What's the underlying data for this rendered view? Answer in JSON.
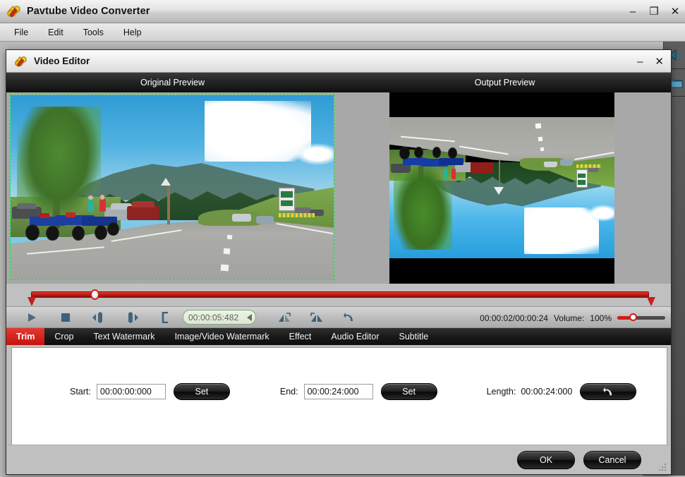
{
  "app": {
    "title": "Pavtube Video Converter",
    "logo_icon": "pavtube-logo-icon",
    "window_controls": {
      "minimize": "–",
      "maximize": "❐",
      "close": "✕"
    },
    "menu": [
      {
        "label": "File"
      },
      {
        "label": "Edit"
      },
      {
        "label": "Tools"
      },
      {
        "label": "Help"
      }
    ],
    "rail_icons": [
      "speaker-icon",
      "folder-icon"
    ]
  },
  "dialog": {
    "title": "Video Editor",
    "logo_icon": "pavtube-logo-icon",
    "window_controls": {
      "minimize": "–",
      "close": "✕"
    },
    "preview": {
      "original_label": "Original Preview",
      "output_label": "Output Preview",
      "original_has_crop_border": true,
      "output_flipped_vertical": true,
      "output_letterboxed": true
    },
    "timeline": {
      "position_percent": 10.5,
      "start_marker": "trim-start-marker",
      "end_marker": "trim-end-marker"
    },
    "controls": {
      "buttons": [
        {
          "name": "play-button",
          "icon": "play-icon"
        },
        {
          "name": "stop-button",
          "icon": "stop-icon"
        },
        {
          "name": "previous-frame-button",
          "icon": "previous-frame-icon"
        },
        {
          "name": "next-frame-button",
          "icon": "next-frame-icon"
        },
        {
          "name": "set-marker-button",
          "icon": "bracket-marker-icon"
        }
      ],
      "time_value": "00:00:05:482",
      "transform_buttons": [
        {
          "name": "flip-horizontal-button",
          "icon": "flip-horizontal-icon"
        },
        {
          "name": "flip-vertical-button",
          "icon": "flip-vertical-icon"
        },
        {
          "name": "reset-button",
          "icon": "undo-arrow-icon"
        }
      ],
      "elapsed_total": "00:00:02/00:00:24",
      "volume_label": "Volume:",
      "volume_value": "100%",
      "volume_percent": 30
    },
    "tabs": [
      {
        "label": "Trim",
        "active": true
      },
      {
        "label": "Crop",
        "active": false
      },
      {
        "label": "Text Watermark",
        "active": false
      },
      {
        "label": "Image/Video Watermark",
        "active": false
      },
      {
        "label": "Effect",
        "active": false
      },
      {
        "label": "Audio Editor",
        "active": false
      },
      {
        "label": "Subtitle",
        "active": false
      }
    ],
    "trim_panel": {
      "start_label": "Start:",
      "start_value": "00:00:00:000",
      "start_set_label": "Set",
      "end_label": "End:",
      "end_value": "00:00:24:000",
      "end_set_label": "Set",
      "length_label": "Length:",
      "length_value": "00:00:24:000",
      "reset_icon": "undo-arrow-icon"
    },
    "footer": {
      "ok_label": "OK",
      "cancel_label": "Cancel"
    }
  },
  "colors": {
    "accent_red": "#c7120c",
    "tab_active_red": "#e23a33",
    "crop_border_green": "#22e022",
    "dialog_bg": "#c0c0c0",
    "tab_bar_dark": "#1a1a1a"
  }
}
